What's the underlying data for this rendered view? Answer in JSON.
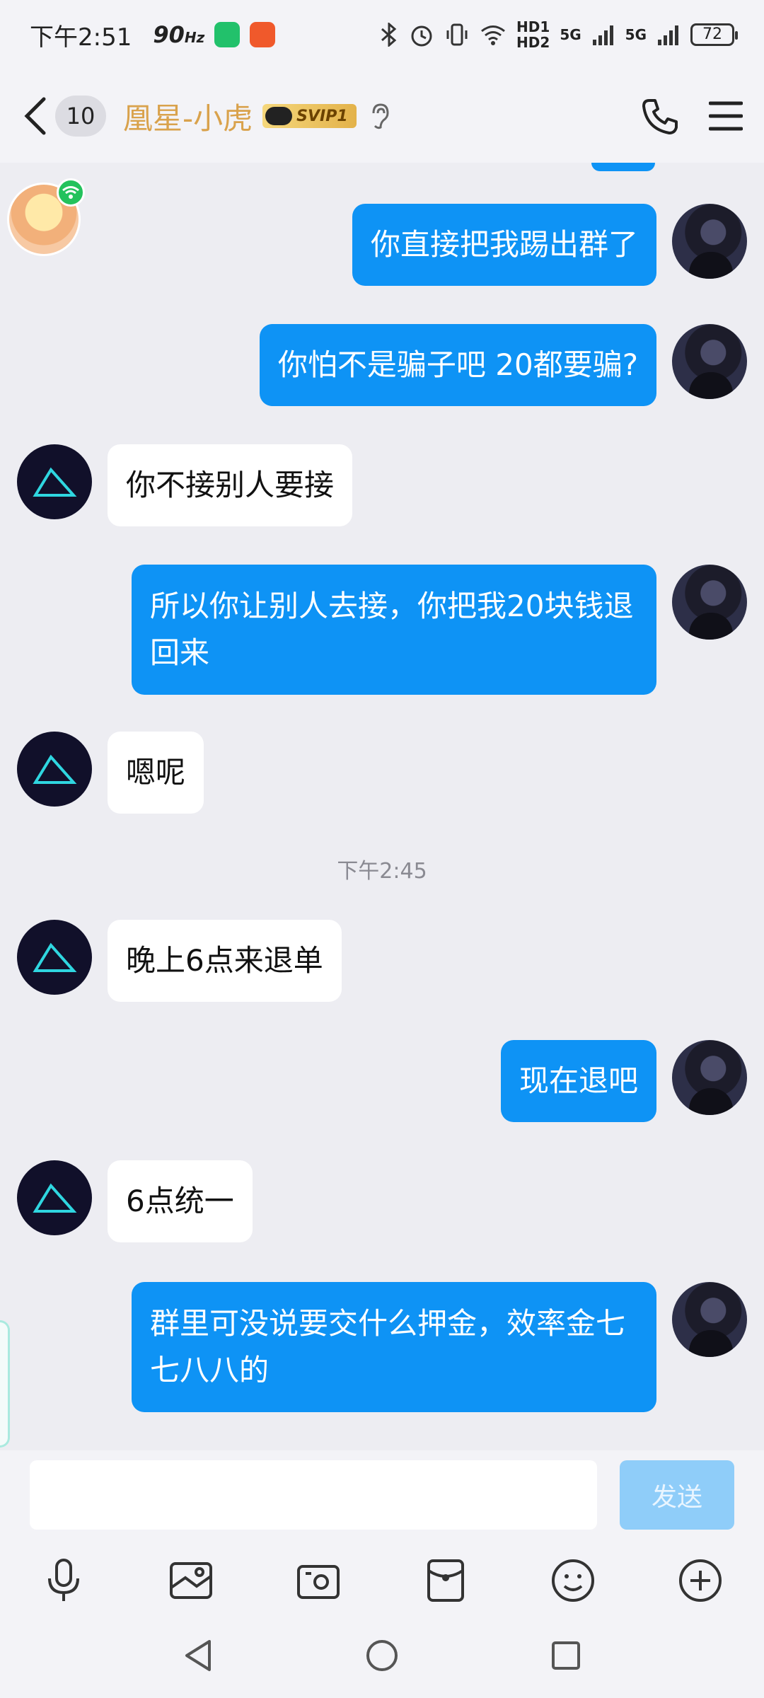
{
  "status_bar": {
    "time": "下午2:51",
    "refresh_rate": "90",
    "refresh_unit": "Hz",
    "hd1": "HD1",
    "hd2": "HD2",
    "net1": "5G",
    "net2": "5G",
    "battery": "72"
  },
  "header": {
    "unread_count": "10",
    "title": "凰星-小虎",
    "vip_badge": "SVIP1"
  },
  "messages": [
    {
      "sender": "me",
      "text": "你直接把我踢出群了"
    },
    {
      "sender": "me",
      "text": "你怕不是骗子吧 20都要骗?"
    },
    {
      "sender": "them",
      "text": "你不接别人要接"
    },
    {
      "sender": "me",
      "text": "所以你让别人去接，你把我20块钱退回来"
    },
    {
      "sender": "them",
      "text": "嗯呢"
    },
    {
      "sender": "them",
      "text": "晚上6点来退单"
    },
    {
      "sender": "me",
      "text": "现在退吧"
    },
    {
      "sender": "them",
      "text": "6点统一"
    },
    {
      "sender": "me",
      "text": "群里可没说要交什么押金，效率金七七八八的"
    }
  ],
  "timestamp": "下午2:45",
  "input": {
    "value": "",
    "send_label": "发送"
  },
  "colors": {
    "my_bubble": "#0e93f5",
    "their_bubble": "#ffffff",
    "title": "#d9a24c",
    "send_disabled": "#8fcdf9"
  },
  "icons": {
    "toolbar": [
      "microphone-icon",
      "image-icon",
      "camera-icon",
      "red-packet-icon",
      "emoji-icon",
      "plus-icon"
    ],
    "nav": [
      "back-icon",
      "phone-icon",
      "menu-icon",
      "ear-icon"
    ]
  }
}
